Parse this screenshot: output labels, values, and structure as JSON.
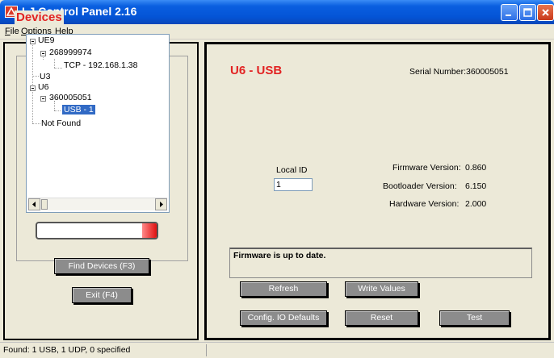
{
  "window": {
    "title": "LJ Control Panel 2.16"
  },
  "menu": [
    "File",
    "Options",
    "Help"
  ],
  "devices": {
    "title": "Devices",
    "tree": {
      "ue9": "UE9",
      "ue9_serial": "268999974",
      "ue9_conn": "TCP - 192.168.1.38",
      "u3": "U3",
      "u6": "U6",
      "u6_serial": "360005051",
      "u6_conn": "USB - 1",
      "not_found": "Not Found"
    },
    "progress_fraction": 0.12,
    "find_button": "Find Devices (F3)",
    "exit_button": "Exit (F4)"
  },
  "detail": {
    "heading": "U6 - USB",
    "serial_label": "Serial Number:",
    "serial_value": "360005051",
    "local_id_label": "Local ID",
    "local_id_value": "1",
    "firmware_label": "Firmware Version:",
    "firmware_value": "0.860",
    "bootloader_label": "Bootloader Version:",
    "bootloader_value": "6.150",
    "hardware_label": "Hardware Version:",
    "hardware_value": "2.000",
    "status_message": "Firmware is up to date.",
    "buttons": {
      "refresh": "Refresh",
      "write_values": "Write Values",
      "config_io": "Config. IO Defaults",
      "reset": "Reset",
      "test": "Test"
    }
  },
  "statusbar": {
    "text": "Found: 1 USB, 1 UDP, 0 specified"
  },
  "colors": {
    "accent_red": "#e22222",
    "selection_blue": "#316ac5",
    "button_gray": "#8c8c8c"
  }
}
